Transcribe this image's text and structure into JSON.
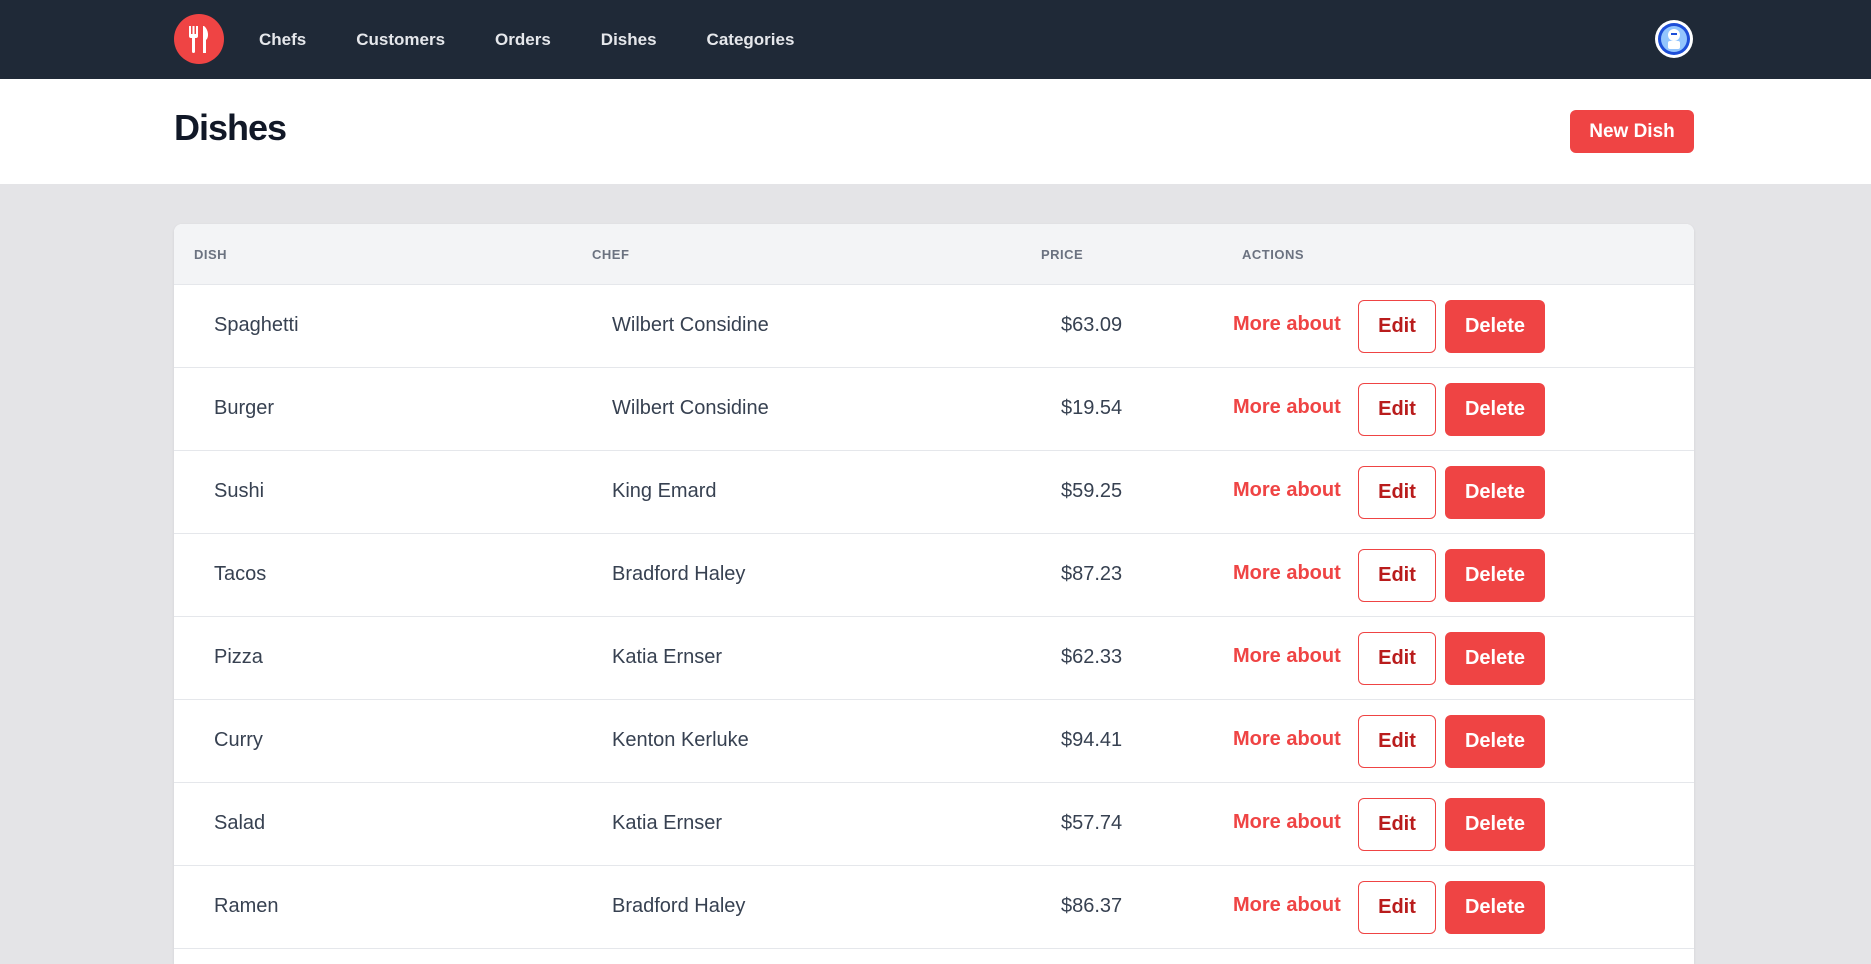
{
  "nav": {
    "logo_icon": "utensils-icon",
    "links": [
      "Chefs",
      "Customers",
      "Orders",
      "Dishes",
      "Categories"
    ],
    "avatar_icon": "user-avatar-icon"
  },
  "header": {
    "title": "Dishes",
    "new_button": "New Dish"
  },
  "table": {
    "columns": [
      "DISH",
      "CHEF",
      "PRICE",
      "ACTIONS"
    ],
    "actions": {
      "more": "More about",
      "edit": "Edit",
      "delete": "Delete"
    },
    "rows": [
      {
        "dish": "Spaghetti",
        "chef": "Wilbert Considine",
        "price": "$63.09"
      },
      {
        "dish": "Burger",
        "chef": "Wilbert Considine",
        "price": "$19.54"
      },
      {
        "dish": "Sushi",
        "chef": "King Emard",
        "price": "$59.25"
      },
      {
        "dish": "Tacos",
        "chef": "Bradford Haley",
        "price": "$87.23"
      },
      {
        "dish": "Pizza",
        "chef": "Katia Ernser",
        "price": "$62.33"
      },
      {
        "dish": "Curry",
        "chef": "Kenton Kerluke",
        "price": "$94.41"
      },
      {
        "dish": "Salad",
        "chef": "Katia Ernser",
        "price": "$57.74"
      },
      {
        "dish": "Ramen",
        "chef": "Bradford Haley",
        "price": "$86.37"
      }
    ]
  },
  "colors": {
    "nav_bg": "#1f2937",
    "accent": "#ef4444",
    "page_bg": "#e4e4e7"
  }
}
